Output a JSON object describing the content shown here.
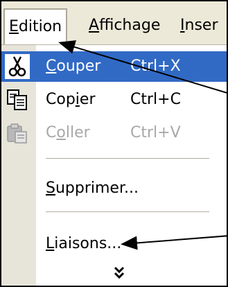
{
  "menubar": {
    "edition": "Edition",
    "affichage": "Affichage",
    "insertion": "Inser"
  },
  "menu": {
    "items": [
      {
        "label": "Couper",
        "shortcut": "Ctrl+X",
        "icon": "scissors-icon",
        "state": "highlighted"
      },
      {
        "label": "Copier",
        "shortcut": "Ctrl+C",
        "icon": "copy-icon",
        "state": "normal"
      },
      {
        "label": "Coller",
        "shortcut": "Ctrl+V",
        "icon": "paste-icon",
        "state": "disabled"
      },
      {
        "label": "Supprimer...",
        "shortcut": "",
        "state": "normal"
      },
      {
        "label": "Liaisons...",
        "shortcut": "",
        "state": "normal"
      }
    ],
    "expand_icon": "double-chevron-down-icon"
  },
  "colors": {
    "highlight": "#316ac5",
    "menubar": "#ece9d8",
    "disabled_text": "#a8a8a8",
    "arrow": "#000000"
  }
}
